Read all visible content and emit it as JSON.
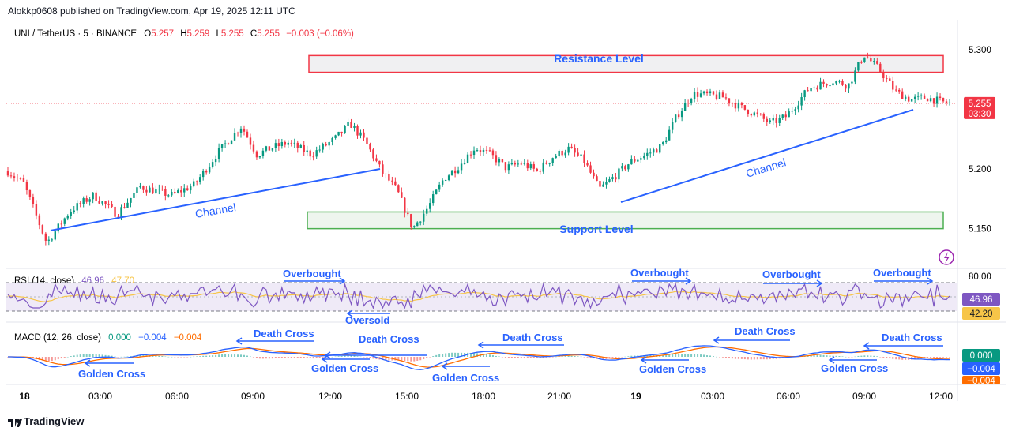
{
  "header": {
    "publisher_line": "Alokkp0608 published on TradingView.com, Apr 19, 2025 12:11 UTC"
  },
  "footer": {
    "brand": "TradingView"
  },
  "colors": {
    "up": "#089981",
    "down": "#f23645",
    "trendline": "#2962ff",
    "annotation": "#2962ff",
    "resistance": "#f23645",
    "support": "#4caf50",
    "rsi_line": "#7e57c2",
    "rsi_ma": "#f7c548",
    "macd_line": "#2962ff",
    "signal_line": "#ff6d00"
  },
  "chart_data": [
    {
      "type": "candlestick",
      "symbol_line": {
        "symbol": "UNI / TetherUS · 5 · BINANCE",
        "o_label": "O",
        "o": "5.257",
        "h_label": "H",
        "h": "5.259",
        "l_label": "L",
        "l": "5.255",
        "c_label": "C",
        "c": "5.255",
        "change": "−0.003 (−0.06%)"
      },
      "y_ticks": [
        "5.300",
        "5.250",
        "5.200",
        "5.150"
      ],
      "y_tick_values": [
        5.3,
        5.25,
        5.2,
        5.15
      ],
      "ylim": [
        5.12,
        5.325
      ],
      "x_ticks": [
        "18",
        "03:00",
        "06:00",
        "09:00",
        "12:00",
        "15:00",
        "18:00",
        "21:00",
        "19",
        "03:00",
        "06:00",
        "09:00",
        "12:00"
      ],
      "last_price": "5.255",
      "last_price_value": 5.255,
      "countdown": "03:30",
      "price_path": [
        [
          0,
          5.198
        ],
        [
          0.02,
          5.188
        ],
        [
          0.05,
          5.138
        ],
        [
          0.08,
          5.165
        ],
        [
          0.11,
          5.178
        ],
        [
          0.14,
          5.162
        ],
        [
          0.17,
          5.185
        ],
        [
          0.21,
          5.178
        ],
        [
          0.24,
          5.187
        ],
        [
          0.27,
          5.214
        ],
        [
          0.3,
          5.236
        ],
        [
          0.32,
          5.212
        ],
        [
          0.34,
          5.218
        ],
        [
          0.36,
          5.222
        ],
        [
          0.39,
          5.212
        ],
        [
          0.42,
          5.225
        ],
        [
          0.44,
          5.238
        ],
        [
          0.46,
          5.222
        ],
        [
          0.48,
          5.198
        ],
        [
          0.5,
          5.182
        ],
        [
          0.52,
          5.15
        ],
        [
          0.54,
          5.168
        ],
        [
          0.56,
          5.192
        ],
        [
          0.58,
          5.203
        ],
        [
          0.6,
          5.218
        ],
        [
          0.62,
          5.212
        ],
        [
          0.64,
          5.201
        ],
        [
          0.66,
          5.205
        ],
        [
          0.68,
          5.198
        ],
        [
          0.7,
          5.21
        ],
        [
          0.72,
          5.217
        ],
        [
          0.74,
          5.207
        ],
        [
          0.76,
          5.183
        ],
        [
          0.78,
          5.194
        ],
        [
          0.8,
          5.206
        ],
        [
          0.82,
          5.212
        ],
        [
          0.84,
          5.219
        ],
        [
          0.86,
          5.245
        ],
        [
          0.88,
          5.263
        ],
        [
          0.9,
          5.262
        ],
        [
          0.92,
          5.26
        ],
        [
          0.94,
          5.252
        ],
        [
          0.96,
          5.246
        ],
        [
          0.98,
          5.238
        ],
        [
          1.0,
          5.244
        ],
        [
          1.03,
          5.268
        ],
        [
          1.06,
          5.274
        ],
        [
          1.08,
          5.27
        ],
        [
          1.1,
          5.296
        ],
        [
          1.12,
          5.283
        ],
        [
          1.14,
          5.265
        ],
        [
          1.16,
          5.258
        ],
        [
          1.18,
          5.26
        ],
        [
          1.2,
          5.256
        ],
        [
          1.21,
          5.255
        ]
      ],
      "annotations": {
        "resistance_label": "Resistance Level",
        "support_label": "Support Level",
        "channel_labels": [
          "Channel",
          "Channel"
        ],
        "resistance_zone": [
          5.281,
          5.295
        ],
        "support_zone": [
          5.15,
          5.164
        ]
      }
    },
    {
      "type": "line",
      "name": "RSI",
      "label": "RSI (14, close)",
      "values_text": [
        "46.96",
        "47.70"
      ],
      "levels": [
        "80.00"
      ],
      "current": "46.96",
      "ma_current": "42.20",
      "annotations": [
        "Overbought",
        "Oversold",
        "Overbought",
        "Overbought",
        "Overbought"
      ]
    },
    {
      "type": "line",
      "name": "MACD",
      "label": "MACD (12, 26, close)",
      "values_text": [
        "0.000",
        "−0.004",
        "−0.004"
      ],
      "axis_values": [
        "0.000",
        "−0.004",
        "−0.004"
      ],
      "annotations": [
        "Death Cross",
        "Death Cross",
        "Death Cross",
        "Death Cross",
        "Death Cross",
        "Golden Cross",
        "Golden Cross",
        "Golden Cross",
        "Golden Cross",
        "Golden Cross"
      ]
    }
  ]
}
